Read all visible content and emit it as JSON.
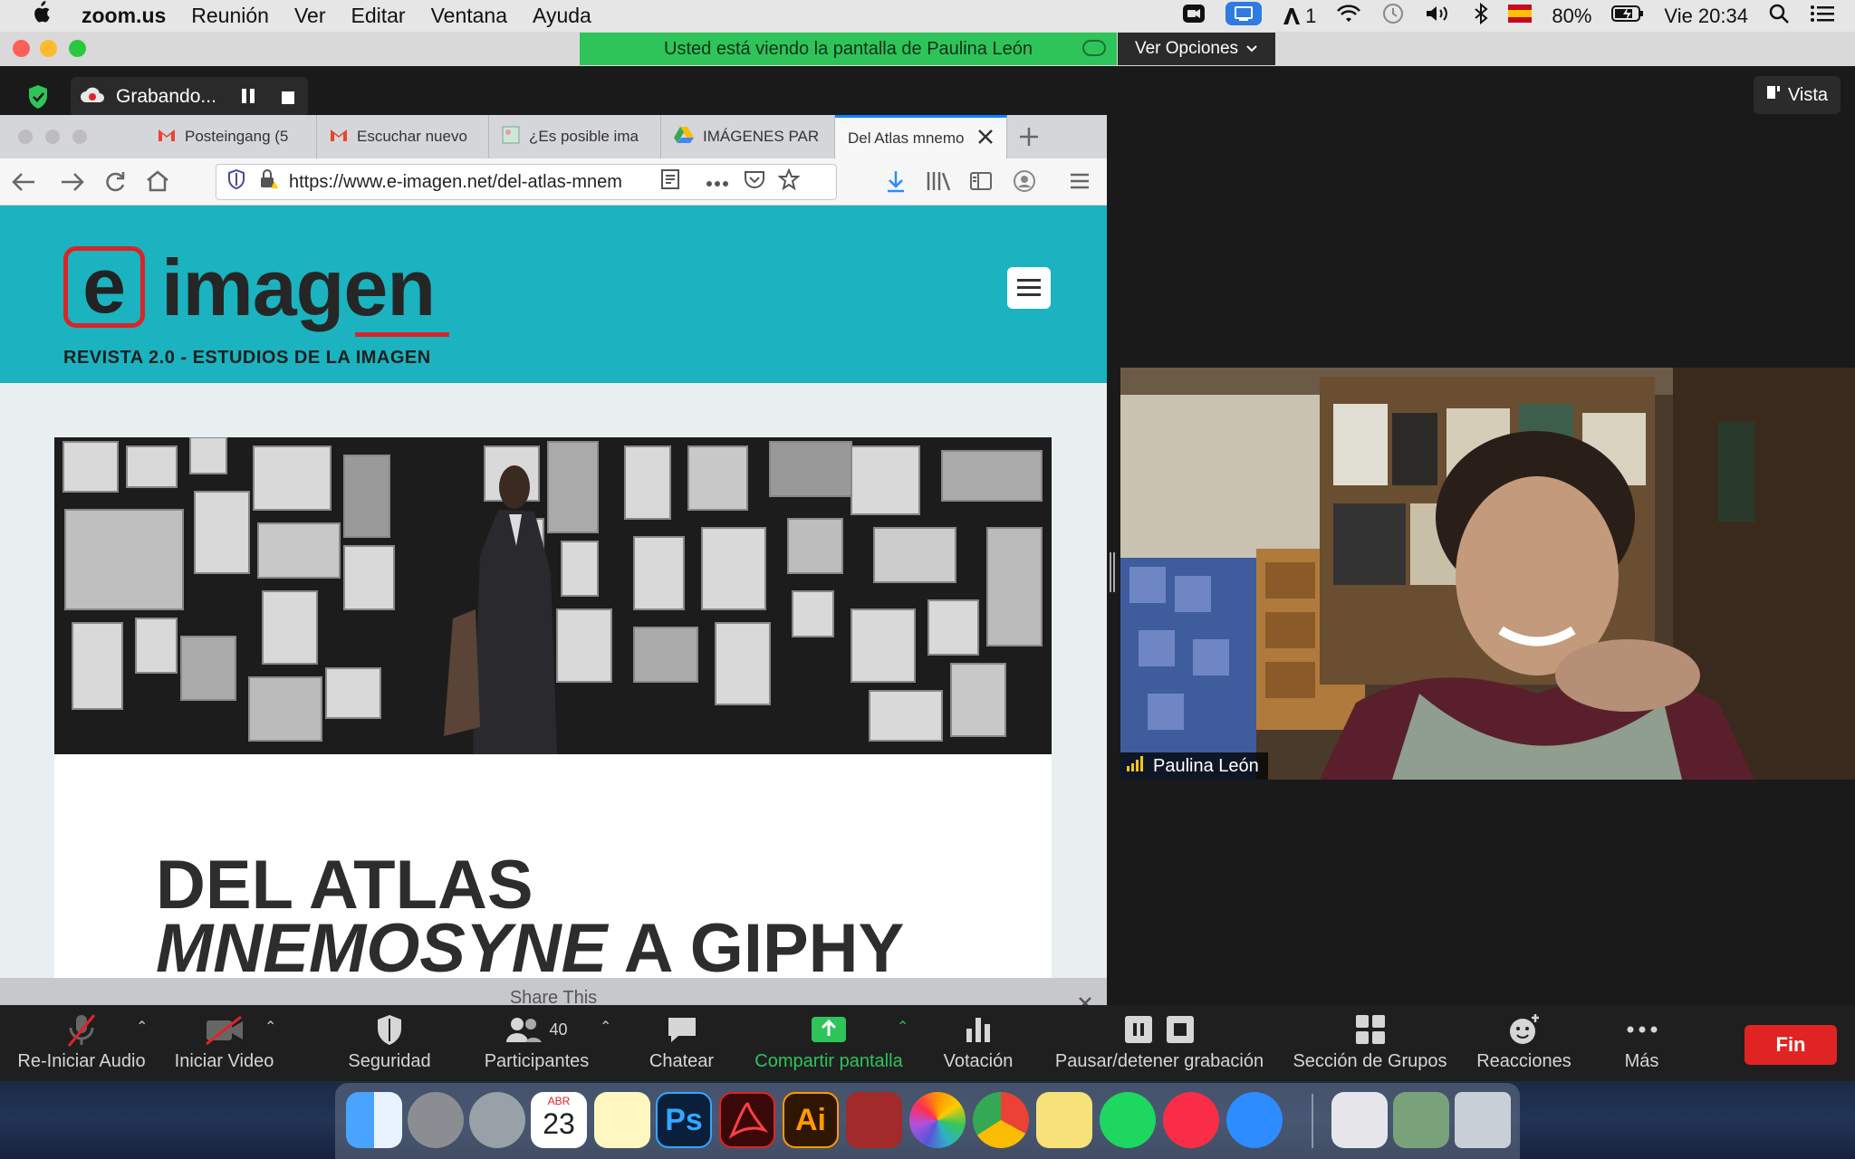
{
  "menubar": {
    "app": "zoom.us",
    "menus": [
      "Reunión",
      "Ver",
      "Editar",
      "Ventana",
      "Ayuda"
    ],
    "text_badge": "1",
    "battery": "80%",
    "clock": "Vie 20:34"
  },
  "zoom": {
    "share_banner": "Usted está viendo la pantalla de Paulina León",
    "view_options": "Ver Opciones",
    "recording_label": "Grabando...",
    "vista_label": "Vista",
    "participant_name": "Paulina León"
  },
  "browser": {
    "tabs": [
      {
        "label": "Posteingang (5",
        "icon": "gmail-icon"
      },
      {
        "label": "Escuchar nuevo",
        "icon": "gmail-icon"
      },
      {
        "label": "¿Es posible ima",
        "icon": "image-site-icon"
      },
      {
        "label": "IMÁGENES PAR",
        "icon": "drive-icon"
      },
      {
        "label": "Del Atlas mnemo",
        "icon": "none"
      }
    ],
    "url": "https://www.e-imagen.net/del-atlas-mnem"
  },
  "site": {
    "logo_e": "e",
    "logo_word": "imagen",
    "tagline": "REVISTA 2.0 - ESTUDIOS DE LA IMAGEN",
    "article_title_line1": "DEL ATLAS",
    "article_title_em": "MNEMOSYNE",
    "article_title_rest": " A GIPHY",
    "share_this": "Share This"
  },
  "toolbar": {
    "audio": "Re-Iniciar Audio",
    "video": "Iniciar Video",
    "security": "Seguridad",
    "participants": "Participantes",
    "participants_count": "40",
    "chat": "Chatear",
    "share": "Compartir pantalla",
    "poll": "Votación",
    "record": "Pausar/detener grabación",
    "breakout": "Sección de Grupos",
    "reactions": "Reacciones",
    "more": "Más",
    "end": "Fin"
  },
  "dock": {
    "calendar_month": "ABR",
    "calendar_day": "23",
    "items": [
      "finder-icon",
      "system-preferences-icon",
      "launchpad-icon",
      "calendar-icon",
      "notes-icon",
      "photoshop-icon",
      "acrobat-icon",
      "illustrator-icon",
      "photo-booth-icon",
      "photos-icon",
      "chrome-icon",
      "stickies-icon",
      "spotify-icon",
      "music-icon",
      "zoom-icon",
      "music-folder-icon",
      "preview-icon",
      "trash-icon"
    ],
    "ps_label": "Ps",
    "ai_label": "Ai"
  },
  "colors": {
    "accent_green": "#2ec45a",
    "site_teal": "#1bb3bf",
    "logo_red": "#d92526",
    "end_red": "#e02424"
  }
}
